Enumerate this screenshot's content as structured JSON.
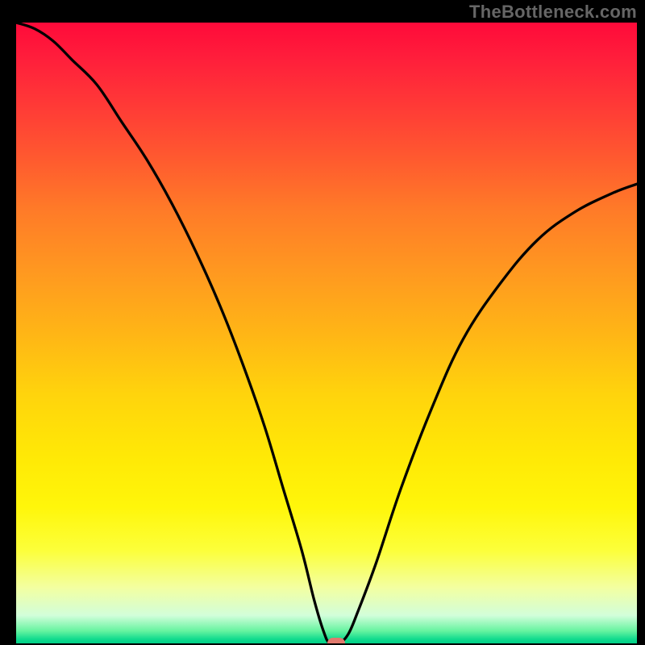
{
  "watermark": "TheBottleneck.com",
  "chart_data": {
    "type": "line",
    "title": "",
    "xlabel": "",
    "ylabel": "",
    "xlim": [
      0,
      100
    ],
    "ylim": [
      0,
      100
    ],
    "x": [
      0,
      3,
      6,
      9,
      13,
      17,
      21,
      25,
      29,
      33,
      36.5,
      40,
      43,
      46,
      48,
      49.5,
      50.5,
      52,
      53.5,
      55,
      58,
      62,
      67,
      72,
      78,
      84,
      90,
      96,
      100
    ],
    "values": [
      100,
      99,
      97,
      94,
      90,
      84,
      78,
      71,
      63,
      54,
      45,
      35,
      25,
      15,
      7,
      2,
      0,
      0,
      1.5,
      5,
      13,
      25,
      38,
      49,
      58,
      65,
      69.5,
      72.5,
      74
    ],
    "marker": {
      "x": 51.5,
      "y": 0
    },
    "colors": {
      "curve": "#000000",
      "marker": "#e17a6e",
      "gradient_top": "#ff0a3a",
      "gradient_bottom": "#00cf86"
    }
  }
}
